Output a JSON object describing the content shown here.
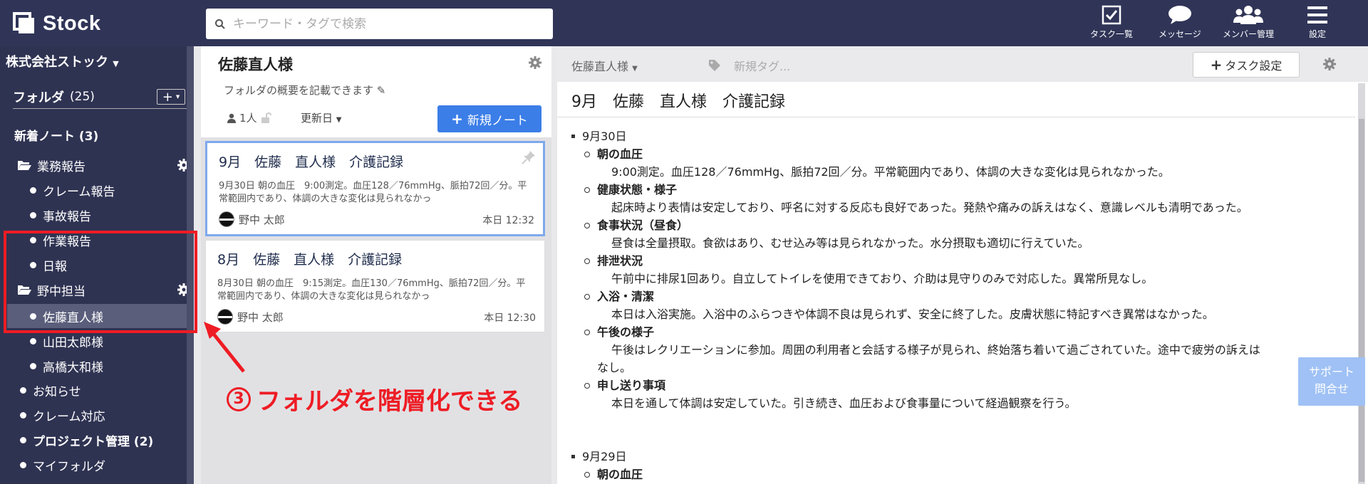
{
  "header": {
    "brand": "Stock",
    "search_placeholder": "キーワード・タグで検索",
    "nav": [
      {
        "label": "タスク一覧",
        "icon": "task-check-icon"
      },
      {
        "label": "メッセージ",
        "icon": "speech-bubble-icon"
      },
      {
        "label": "メンバー管理",
        "icon": "members-icon"
      },
      {
        "label": "設定",
        "icon": "menu-icon"
      }
    ]
  },
  "sidebar": {
    "company": "株式会社ストック",
    "folder_label": "フォルダ",
    "folder_count": "(25)",
    "add_label": "+",
    "new_notes": "新着ノート (3)",
    "items": [
      {
        "label": "業務報告",
        "type": "folder-open"
      },
      {
        "label": "クレーム報告",
        "type": "sub"
      },
      {
        "label": "事故報告",
        "type": "sub"
      },
      {
        "label": "作業報告",
        "type": "sub"
      },
      {
        "label": "日報",
        "type": "sub"
      },
      {
        "label": "野中担当",
        "type": "folder-open"
      },
      {
        "label": "佐藤直人様",
        "type": "sub",
        "selected": true
      },
      {
        "label": "山田太郎様",
        "type": "sub"
      },
      {
        "label": "高橋大和様",
        "type": "sub"
      },
      {
        "label": "お知らせ",
        "type": "top"
      },
      {
        "label": "クレーム対応",
        "type": "top"
      },
      {
        "label": "プロジェクト管理 (2)",
        "type": "top-bold"
      },
      {
        "label": "マイフォルダ",
        "type": "top"
      }
    ]
  },
  "folder": {
    "title": "佐藤直人様",
    "description": "フォルダの概要を記載できます",
    "members": "1人",
    "sort": "更新日",
    "new_note": "新規ノート"
  },
  "notes": [
    {
      "title": "9月　佐藤　直人様　介護記録",
      "excerpt": "9月30日 朝の血圧　9:00測定。血圧128／76mmHg、脈拍72回／分。平常範囲内であり、体調の大きな変化は見られなかっ",
      "author": "野中 太郎",
      "time": "本日 12:32"
    },
    {
      "title": "8月　佐藤　直人様　介護記録",
      "excerpt": "8月30日 朝の血圧　9:15測定。血圧130／76mmHg、脈拍72回／分。平常範囲内であり、体調の大きな変化は見られなかっ",
      "author": "野中 太郎",
      "time": "本日 12:30"
    }
  ],
  "annotation": {
    "number": "3",
    "text": "フォルダを階層化できる"
  },
  "editor": {
    "folder": "佐藤直人様",
    "tag_placeholder": "新規タグ...",
    "task_button": "タスク設定",
    "title": "9月　佐藤　直人様　介護記録",
    "date1": "9月30日",
    "sections": [
      {
        "heading": "朝の血圧",
        "body": "9:00測定。血圧128／76mmHg、脈拍72回／分。平常範囲内であり、体調の大きな変化は見られなかった。"
      },
      {
        "heading": "健康状態・様子",
        "body": "起床時より表情は安定しており、呼名に対する反応も良好であった。発熱や痛みの訴えはなく、意識レベルも清明であった。"
      },
      {
        "heading": "食事状況（昼食）",
        "body": "昼食は全量摂取。食欲はあり、むせ込み等は見られなかった。水分摂取も適切に行えていた。"
      },
      {
        "heading": "排泄状況",
        "body": "午前中に排尿1回あり。自立してトイレを使用できており、介助は見守りのみで対応した。異常所見なし。"
      },
      {
        "heading": "入浴・清潔",
        "body": "本日は入浴実施。入浴中のふらつきや体調不良は見られず、安全に終了した。皮膚状態に特記すべき異常はなかった。"
      },
      {
        "heading": "午後の様子",
        "body": "午後はレクリエーションに参加。周囲の利用者と会話する様子が見られ、終始落ち着いて過ごされていた。途中で疲労の訴えは",
        "body2": "なし。"
      },
      {
        "heading": "申し送り事項",
        "body": "本日を通して体調は安定していた。引き続き、血圧および食事量について経過観察を行う。"
      }
    ],
    "date2": "9月29日",
    "date2_first": "朝の血圧"
  },
  "support": {
    "line1": "サポート",
    "line2": "問合せ"
  }
}
